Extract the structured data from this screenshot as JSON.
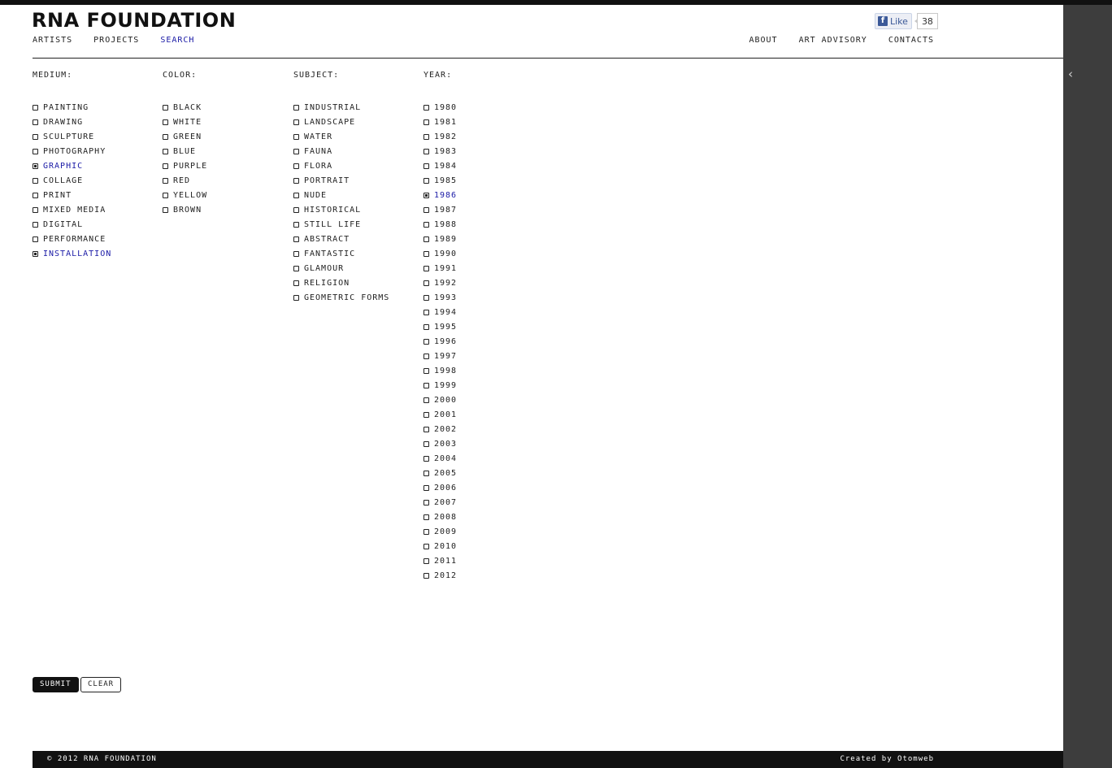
{
  "header": {
    "logo": "RNA FOUNDATION",
    "nav_left": [
      {
        "label": "ARTISTS",
        "active": false
      },
      {
        "label": "PROJECTS",
        "active": false
      },
      {
        "label": "SEARCH",
        "active": true
      }
    ],
    "nav_right": [
      {
        "label": "ABOUT"
      },
      {
        "label": "ART ADVISORY"
      },
      {
        "label": "CONTACTS"
      }
    ],
    "facebook": {
      "like_label": "Like",
      "count": "38"
    }
  },
  "filters": {
    "medium": {
      "heading": "MEDIUM:",
      "options": [
        {
          "label": "PAINTING",
          "checked": false
        },
        {
          "label": "DRAWING",
          "checked": false
        },
        {
          "label": "SCULPTURE",
          "checked": false
        },
        {
          "label": "PHOTOGRAPHY",
          "checked": false
        },
        {
          "label": "GRAPHIC",
          "checked": true
        },
        {
          "label": "COLLAGE",
          "checked": false
        },
        {
          "label": "PRINT",
          "checked": false
        },
        {
          "label": "MIXED MEDIA",
          "checked": false
        },
        {
          "label": "DIGITAL",
          "checked": false
        },
        {
          "label": "PERFORMANCE",
          "checked": false
        },
        {
          "label": "INSTALLATION",
          "checked": true
        }
      ]
    },
    "color": {
      "heading": "COLOR:",
      "options": [
        {
          "label": "BLACK",
          "checked": false
        },
        {
          "label": "WHITE",
          "checked": false
        },
        {
          "label": "GREEN",
          "checked": false
        },
        {
          "label": "BLUE",
          "checked": false
        },
        {
          "label": "PURPLE",
          "checked": false
        },
        {
          "label": "RED",
          "checked": false
        },
        {
          "label": "YELLOW",
          "checked": false
        },
        {
          "label": "BROWN",
          "checked": false
        }
      ]
    },
    "subject": {
      "heading": "SUBJECT:",
      "options": [
        {
          "label": "INDUSTRIAL",
          "checked": false
        },
        {
          "label": "LANDSCAPE",
          "checked": false
        },
        {
          "label": "WATER",
          "checked": false
        },
        {
          "label": "FAUNA",
          "checked": false
        },
        {
          "label": "FLORA",
          "checked": false
        },
        {
          "label": "PORTRAIT",
          "checked": false
        },
        {
          "label": "NUDE",
          "checked": false
        },
        {
          "label": "HISTORICAL",
          "checked": false
        },
        {
          "label": "STILL LIFE",
          "checked": false
        },
        {
          "label": "ABSTRACT",
          "checked": false
        },
        {
          "label": "FANTASTIC",
          "checked": false
        },
        {
          "label": "GLAMOUR",
          "checked": false
        },
        {
          "label": "RELIGION",
          "checked": false
        },
        {
          "label": "GEOMETRIC FORMS",
          "checked": false
        }
      ]
    },
    "year": {
      "heading": "YEAR:",
      "options": [
        {
          "label": "1980",
          "checked": false
        },
        {
          "label": "1981",
          "checked": false
        },
        {
          "label": "1982",
          "checked": false
        },
        {
          "label": "1983",
          "checked": false
        },
        {
          "label": "1984",
          "checked": false
        },
        {
          "label": "1985",
          "checked": false
        },
        {
          "label": "1986",
          "checked": true
        },
        {
          "label": "1987",
          "checked": false
        },
        {
          "label": "1988",
          "checked": false
        },
        {
          "label": "1989",
          "checked": false
        },
        {
          "label": "1990",
          "checked": false
        },
        {
          "label": "1991",
          "checked": false
        },
        {
          "label": "1992",
          "checked": false
        },
        {
          "label": "1993",
          "checked": false
        },
        {
          "label": "1994",
          "checked": false
        },
        {
          "label": "1995",
          "checked": false
        },
        {
          "label": "1996",
          "checked": false
        },
        {
          "label": "1997",
          "checked": false
        },
        {
          "label": "1998",
          "checked": false
        },
        {
          "label": "1999",
          "checked": false
        },
        {
          "label": "2000",
          "checked": false
        },
        {
          "label": "2001",
          "checked": false
        },
        {
          "label": "2002",
          "checked": false
        },
        {
          "label": "2003",
          "checked": false
        },
        {
          "label": "2004",
          "checked": false
        },
        {
          "label": "2005",
          "checked": false
        },
        {
          "label": "2006",
          "checked": false
        },
        {
          "label": "2007",
          "checked": false
        },
        {
          "label": "2008",
          "checked": false
        },
        {
          "label": "2009",
          "checked": false
        },
        {
          "label": "2010",
          "checked": false
        },
        {
          "label": "2011",
          "checked": false
        },
        {
          "label": "2012",
          "checked": false
        }
      ]
    }
  },
  "actions": {
    "submit_label": "SUBMIT",
    "clear_label": "CLEAR"
  },
  "footer": {
    "copyright": "© 2012 RNA FOUNDATION",
    "credit": "Created by Otomweb"
  },
  "side_panel": {
    "toggle_icon": "chevron-left-icon"
  },
  "colors": {
    "accent": "#1a1aa6",
    "dark": "#111111",
    "side_panel": "#3d3d3d"
  }
}
